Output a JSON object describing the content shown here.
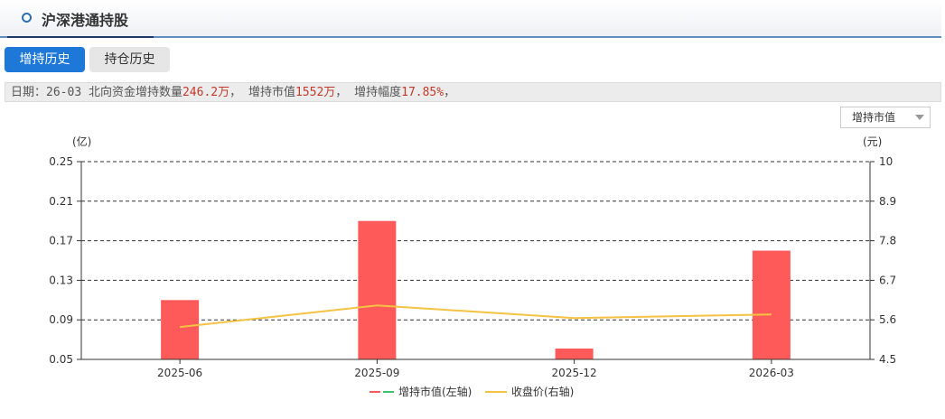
{
  "header": {
    "title": "沪深港通持股"
  },
  "tabs": [
    {
      "label": "增持历史",
      "active": true
    },
    {
      "label": "持仓历史",
      "active": false
    }
  ],
  "info": {
    "date_label": "日期：",
    "date": "26-03",
    "qty_label": " 北向资金增持数量",
    "qty_value": "246.2万",
    "sep1": "，  ",
    "mv_label": "增持市值",
    "mv_value": "1552万",
    "sep2": "，  ",
    "range_label": "增持幅度",
    "range_value": "17.85%",
    "tail": "，"
  },
  "select": {
    "value": "增持市值"
  },
  "colors": {
    "bar": "#fe5a5a",
    "line": "#f5c242",
    "accent": "#1e78d7",
    "legend_dash_green": "#3cc36b"
  },
  "chart_data": {
    "type": "bar",
    "categories": [
      "2025-06",
      "2025-09",
      "2025-12",
      "2026-03"
    ],
    "series": [
      {
        "name": "增持市值(左轴)",
        "type": "bar",
        "axis": "left",
        "values": [
          0.11,
          0.19,
          0.061,
          0.16
        ]
      },
      {
        "name": "收盘价(右轴)",
        "type": "line",
        "axis": "right",
        "values": [
          5.4,
          6.0,
          5.65,
          5.75
        ]
      }
    ],
    "y_left": {
      "unit": "(亿)",
      "ticks": [
        "0.25",
        "0.21",
        "0.17",
        "0.13",
        "0.09",
        "0.05"
      ],
      "ylim": [
        0.05,
        0.25
      ]
    },
    "y_right": {
      "unit": "(元)",
      "ticks": [
        "10",
        "8.9",
        "7.8",
        "6.7",
        "5.6",
        "4.5"
      ],
      "ylim": [
        4.5,
        10
      ]
    },
    "grid": true,
    "legend_position": "bottom"
  }
}
